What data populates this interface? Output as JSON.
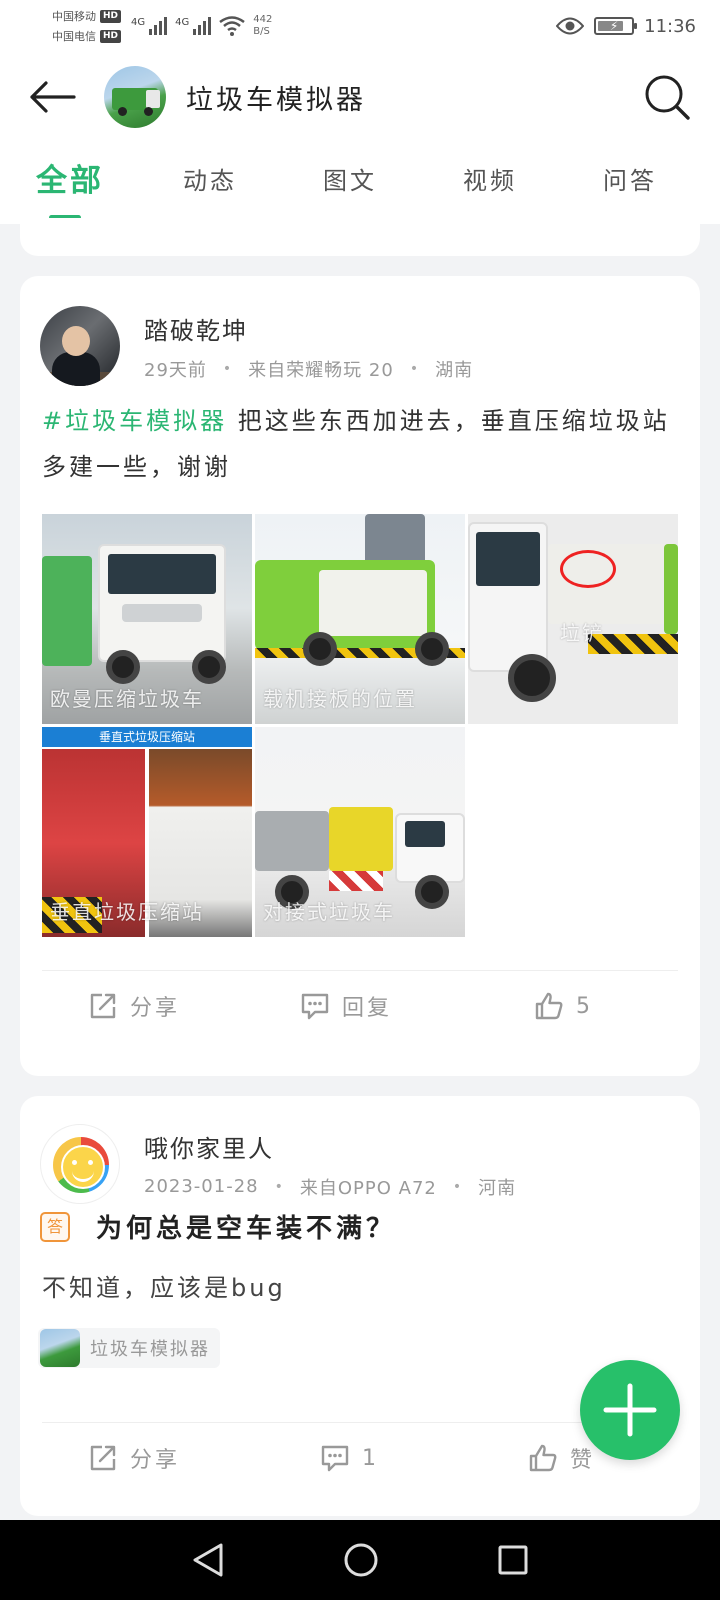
{
  "status_bar": {
    "carrier1": "中国移动",
    "carrier2": "中国电信",
    "hd": "HD",
    "net1": "4G",
    "net2": "4G",
    "speed_value": "442",
    "speed_unit": "B/S",
    "time": "11:36"
  },
  "header": {
    "title": "垃圾车模拟器"
  },
  "tabs": [
    {
      "label": "全部",
      "active": true
    },
    {
      "label": "动态"
    },
    {
      "label": "图文"
    },
    {
      "label": "视频"
    },
    {
      "label": "问答"
    }
  ],
  "posts": [
    {
      "author": "踏破乾坤",
      "time": "29天前",
      "device": "来自荣耀畅玩 20",
      "location": "湖南",
      "hashtag": "#垃圾车模拟器",
      "text": " 把这些东西加进去，垂直压缩垃圾站多建一些，谢谢",
      "images": [
        {
          "caption": "欧曼压缩垃圾车"
        },
        {
          "caption": "载机接板的位置"
        },
        {
          "caption": "垃铲"
        },
        {
          "caption": "垂直垃圾压缩站",
          "banner": "垂直式垃圾压缩站"
        },
        {
          "caption": "对接式垃圾车"
        }
      ],
      "share_label": "分享",
      "reply_label": "回复",
      "like_count": "5"
    },
    {
      "author": "哦你家里人",
      "time": "2023-01-28",
      "device": "来自OPPO A72",
      "location": "河南",
      "qa_badge": "答",
      "question": "为何总是空车装不满？",
      "answer": "不知道，应该是bug",
      "topic": "垃圾车模拟器",
      "share_label": "分享",
      "reply_count": "1",
      "like_label": "赞"
    }
  ],
  "colors": {
    "accent": "#2bb673",
    "fab": "#27c06a",
    "qa_badge": "#f0953a"
  }
}
